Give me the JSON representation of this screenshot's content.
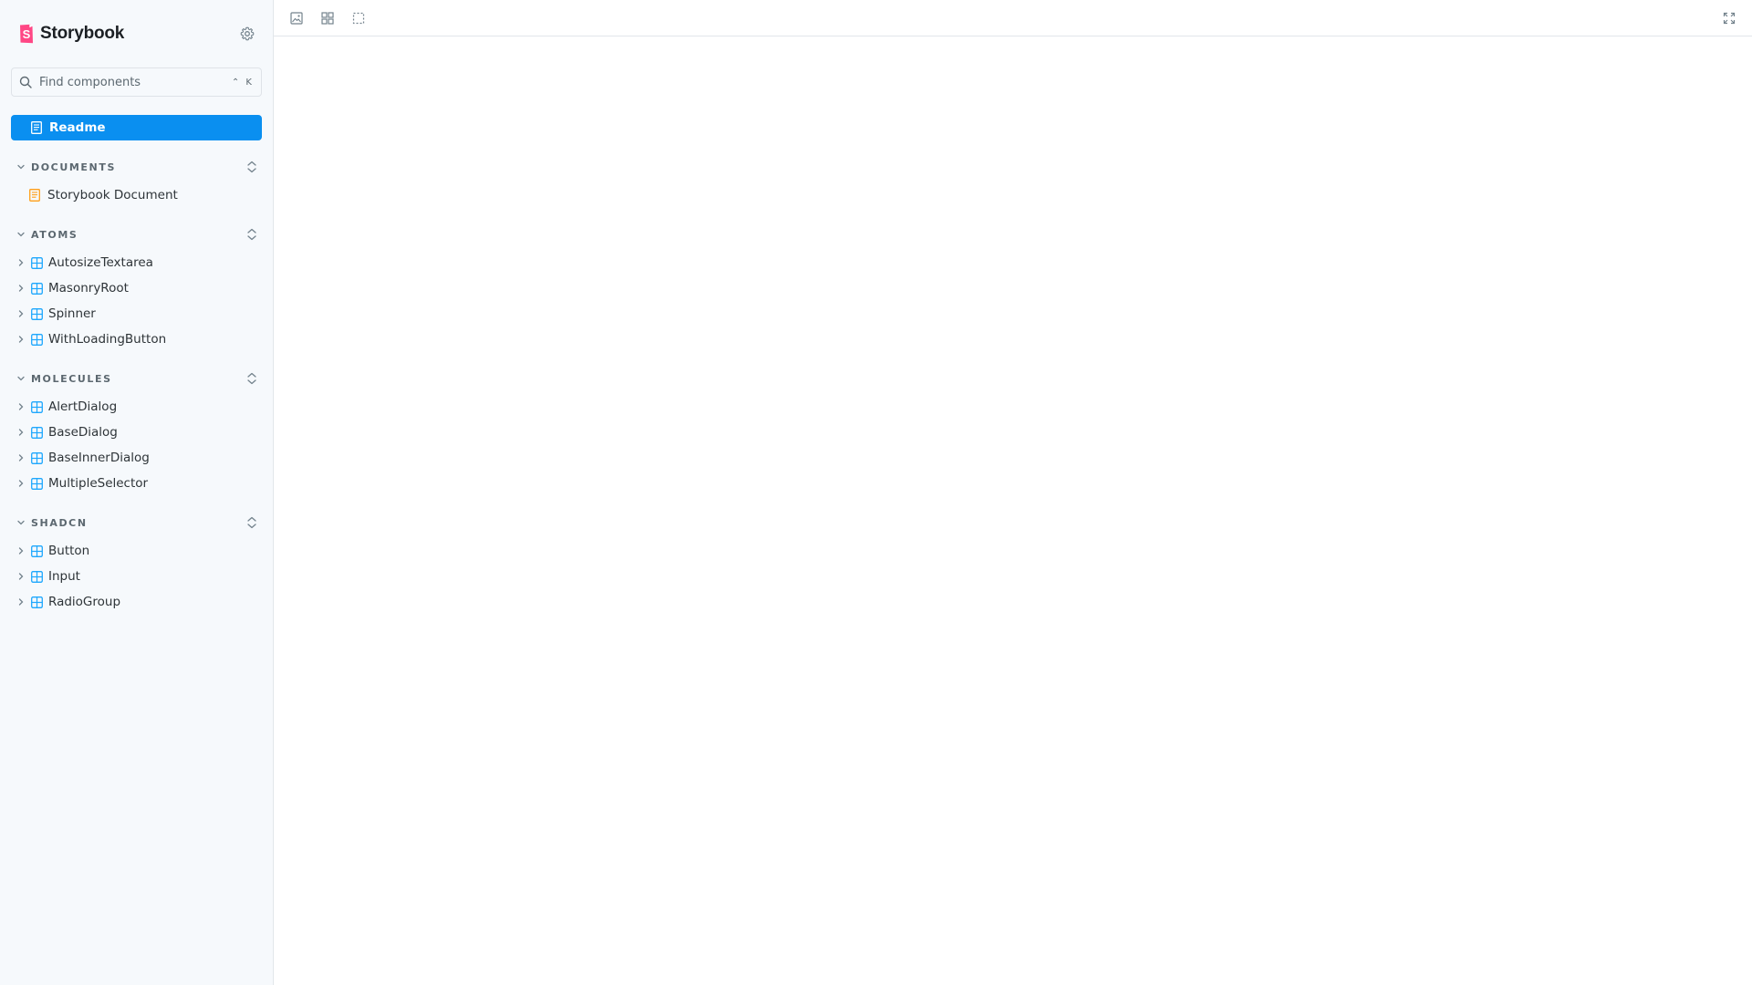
{
  "app": {
    "brand_name": "Storybook",
    "accent": "#0a8ff0",
    "brand_color": "#ff4785"
  },
  "search": {
    "placeholder": "Find components",
    "shortcut": "⌃ K"
  },
  "readme": {
    "label": "Readme"
  },
  "groups": [
    {
      "title": "DOCUMENTS",
      "items": [
        {
          "label": "Storybook Document",
          "icon": "document-icon"
        }
      ]
    },
    {
      "title": "ATOMS",
      "items": [
        {
          "label": "AutosizeTextarea",
          "icon": "component-icon"
        },
        {
          "label": "MasonryRoot",
          "icon": "component-icon"
        },
        {
          "label": "Spinner",
          "icon": "component-icon"
        },
        {
          "label": "WithLoadingButton",
          "icon": "component-icon"
        }
      ]
    },
    {
      "title": "MOLECULES",
      "items": [
        {
          "label": "AlertDialog",
          "icon": "component-icon"
        },
        {
          "label": "BaseDialog",
          "icon": "component-icon"
        },
        {
          "label": "BaseInnerDialog",
          "icon": "component-icon"
        },
        {
          "label": "MultipleSelector",
          "icon": "component-icon"
        }
      ]
    },
    {
      "title": "SHADCN",
      "items": [
        {
          "label": "Button",
          "icon": "component-icon"
        },
        {
          "label": "Input",
          "icon": "component-icon"
        },
        {
          "label": "RadioGroup",
          "icon": "component-icon"
        }
      ]
    }
  ],
  "toolbar": {
    "tools": [
      "image-icon",
      "grid-icon",
      "outline-icon"
    ],
    "fullscreen": "fullscreen-icon"
  }
}
